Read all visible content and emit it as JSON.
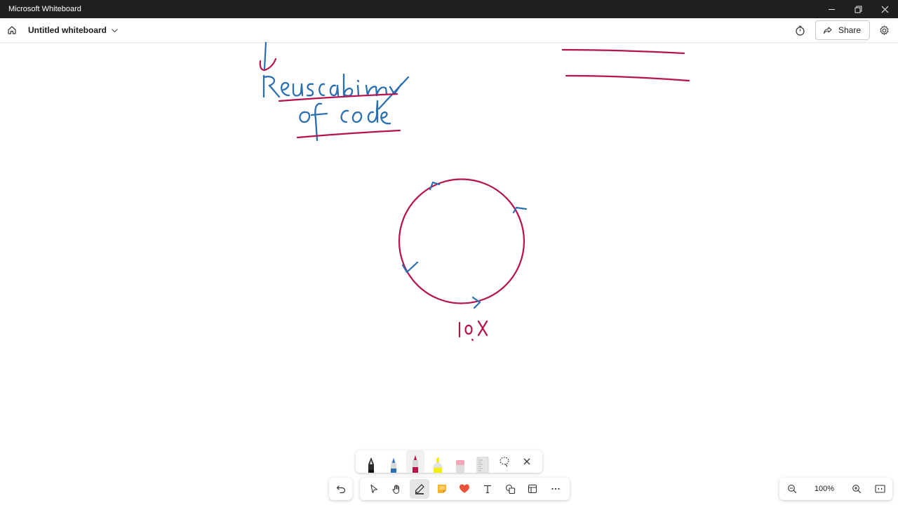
{
  "window": {
    "title": "Microsoft Whiteboard",
    "controls": [
      "minimize-icon",
      "restore-icon",
      "close-icon"
    ]
  },
  "header": {
    "board_title": "Untitled whiteboard",
    "share_label": "Share",
    "icons": [
      "home-icon",
      "chevron-down-icon",
      "timer-icon",
      "share-icon",
      "settings-icon"
    ]
  },
  "canvas": {
    "ink_colors": {
      "blue": "#2a6fb0",
      "crimson": "#b5124f"
    },
    "strokes_description_text": {
      "phrase_line1": "Reusability",
      "phrase_line2": "of code",
      "circle_label": "10X"
    }
  },
  "pen_tray": {
    "items": [
      "black-pen-icon",
      "blue-pen-icon",
      "red-pen-icon",
      "yellow-highlighter-icon",
      "eraser-icon",
      "ruler-icon",
      "lasso-icon",
      "close-icon"
    ],
    "selected": "red-pen-icon"
  },
  "toolbar": {
    "items": [
      "undo-icon",
      "select-icon",
      "pan-hand-icon",
      "pen-icon",
      "sticky-note-icon",
      "reaction-heart-icon",
      "text-icon",
      "shapes-icon",
      "templates-icon",
      "more-icon"
    ],
    "selected": "pen-icon"
  },
  "zoom": {
    "level": "100%",
    "icons": [
      "zoom-out-icon",
      "zoom-in-icon",
      "fit-screen-icon"
    ]
  },
  "colors": {
    "titlebar_bg": "#1f1f1f",
    "accent_ink": "#b5124f"
  }
}
